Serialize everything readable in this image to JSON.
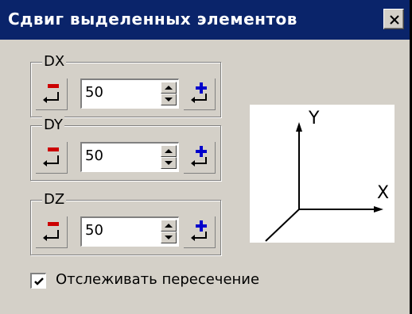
{
  "window": {
    "title": "Сдвиг выделенных элементов",
    "close_label": "X"
  },
  "groups": [
    {
      "label": "DX",
      "value": "50"
    },
    {
      "label": "DY",
      "value": "50"
    },
    {
      "label": "DZ",
      "value": "50"
    }
  ],
  "axes": {
    "y_label": "Y",
    "x_label": "X"
  },
  "track_intersection": {
    "label": "Отслеживать пересечение",
    "checked": true
  },
  "icons": {
    "decrement": "minus-enter-icon",
    "increment": "plus-enter-icon"
  },
  "colors": {
    "titlebar": "#0a246a",
    "minus": "#cc0000",
    "plus": "#0000cc",
    "face": "#d4d0c8"
  }
}
